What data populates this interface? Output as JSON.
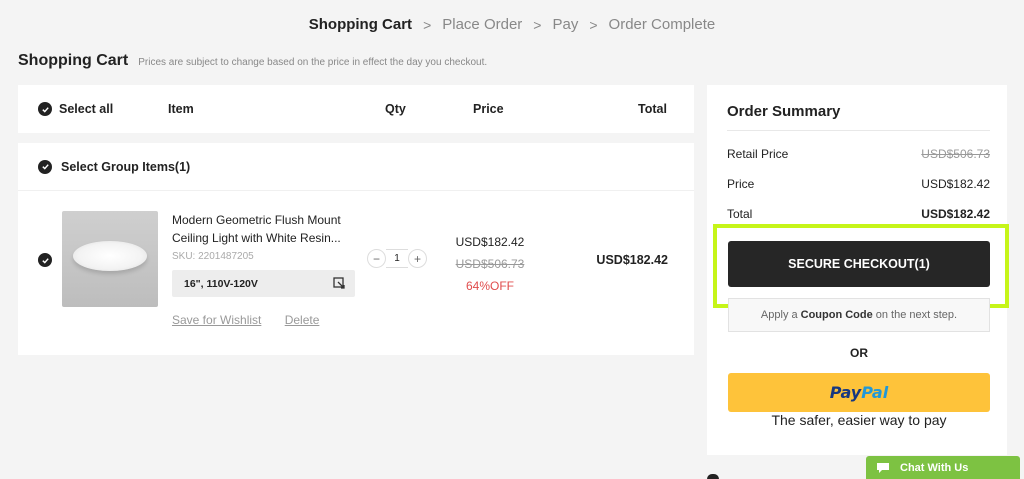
{
  "steps": [
    "Shopping Cart",
    "Place Order",
    "Pay",
    "Order Complete"
  ],
  "heading": {
    "title": "Shopping Cart",
    "note": "Prices are subject to change based on the price in effect the day you checkout."
  },
  "table_header": {
    "select_all": "Select all",
    "item": "Item",
    "qty": "Qty",
    "price": "Price",
    "total": "Total"
  },
  "group": {
    "label": "Select Group Items(1)"
  },
  "item": {
    "name": "Modern Geometric Flush Mount Ceiling Light with White Resin...",
    "sku": "SKU: 2201487205",
    "variant": "16\", 110V-120V",
    "qty": "1",
    "price": "USD$182.42",
    "original_price": "USD$506.73",
    "discount": "64%OFF",
    "total": "USD$182.42",
    "save_wishlist": "Save for Wishlist",
    "delete": "Delete"
  },
  "summary": {
    "title": "Order Summary",
    "retail_label": "Retail Price",
    "retail_value": "USD$506.73",
    "price_label": "Price",
    "price_value": "USD$182.42",
    "total_label": "Total",
    "total_value": "USD$182.42",
    "checkout": "SECURE CHECKOUT(1)",
    "coupon_pre": "Apply a",
    "coupon_bold": "Coupon Code",
    "coupon_post": "on the next step.",
    "or": "OR",
    "paypal_1": "Pay",
    "paypal_2": "Pal",
    "paypal_tagline": "The safer, easier way to pay"
  },
  "chat": {
    "label": "Chat With Us"
  },
  "colors": {
    "highlight": "#c6f519",
    "checkout_bg": "#262626",
    "paypal_bg": "#fec33a",
    "discount": "#e04c4c",
    "chat_bg": "#7dc242"
  }
}
